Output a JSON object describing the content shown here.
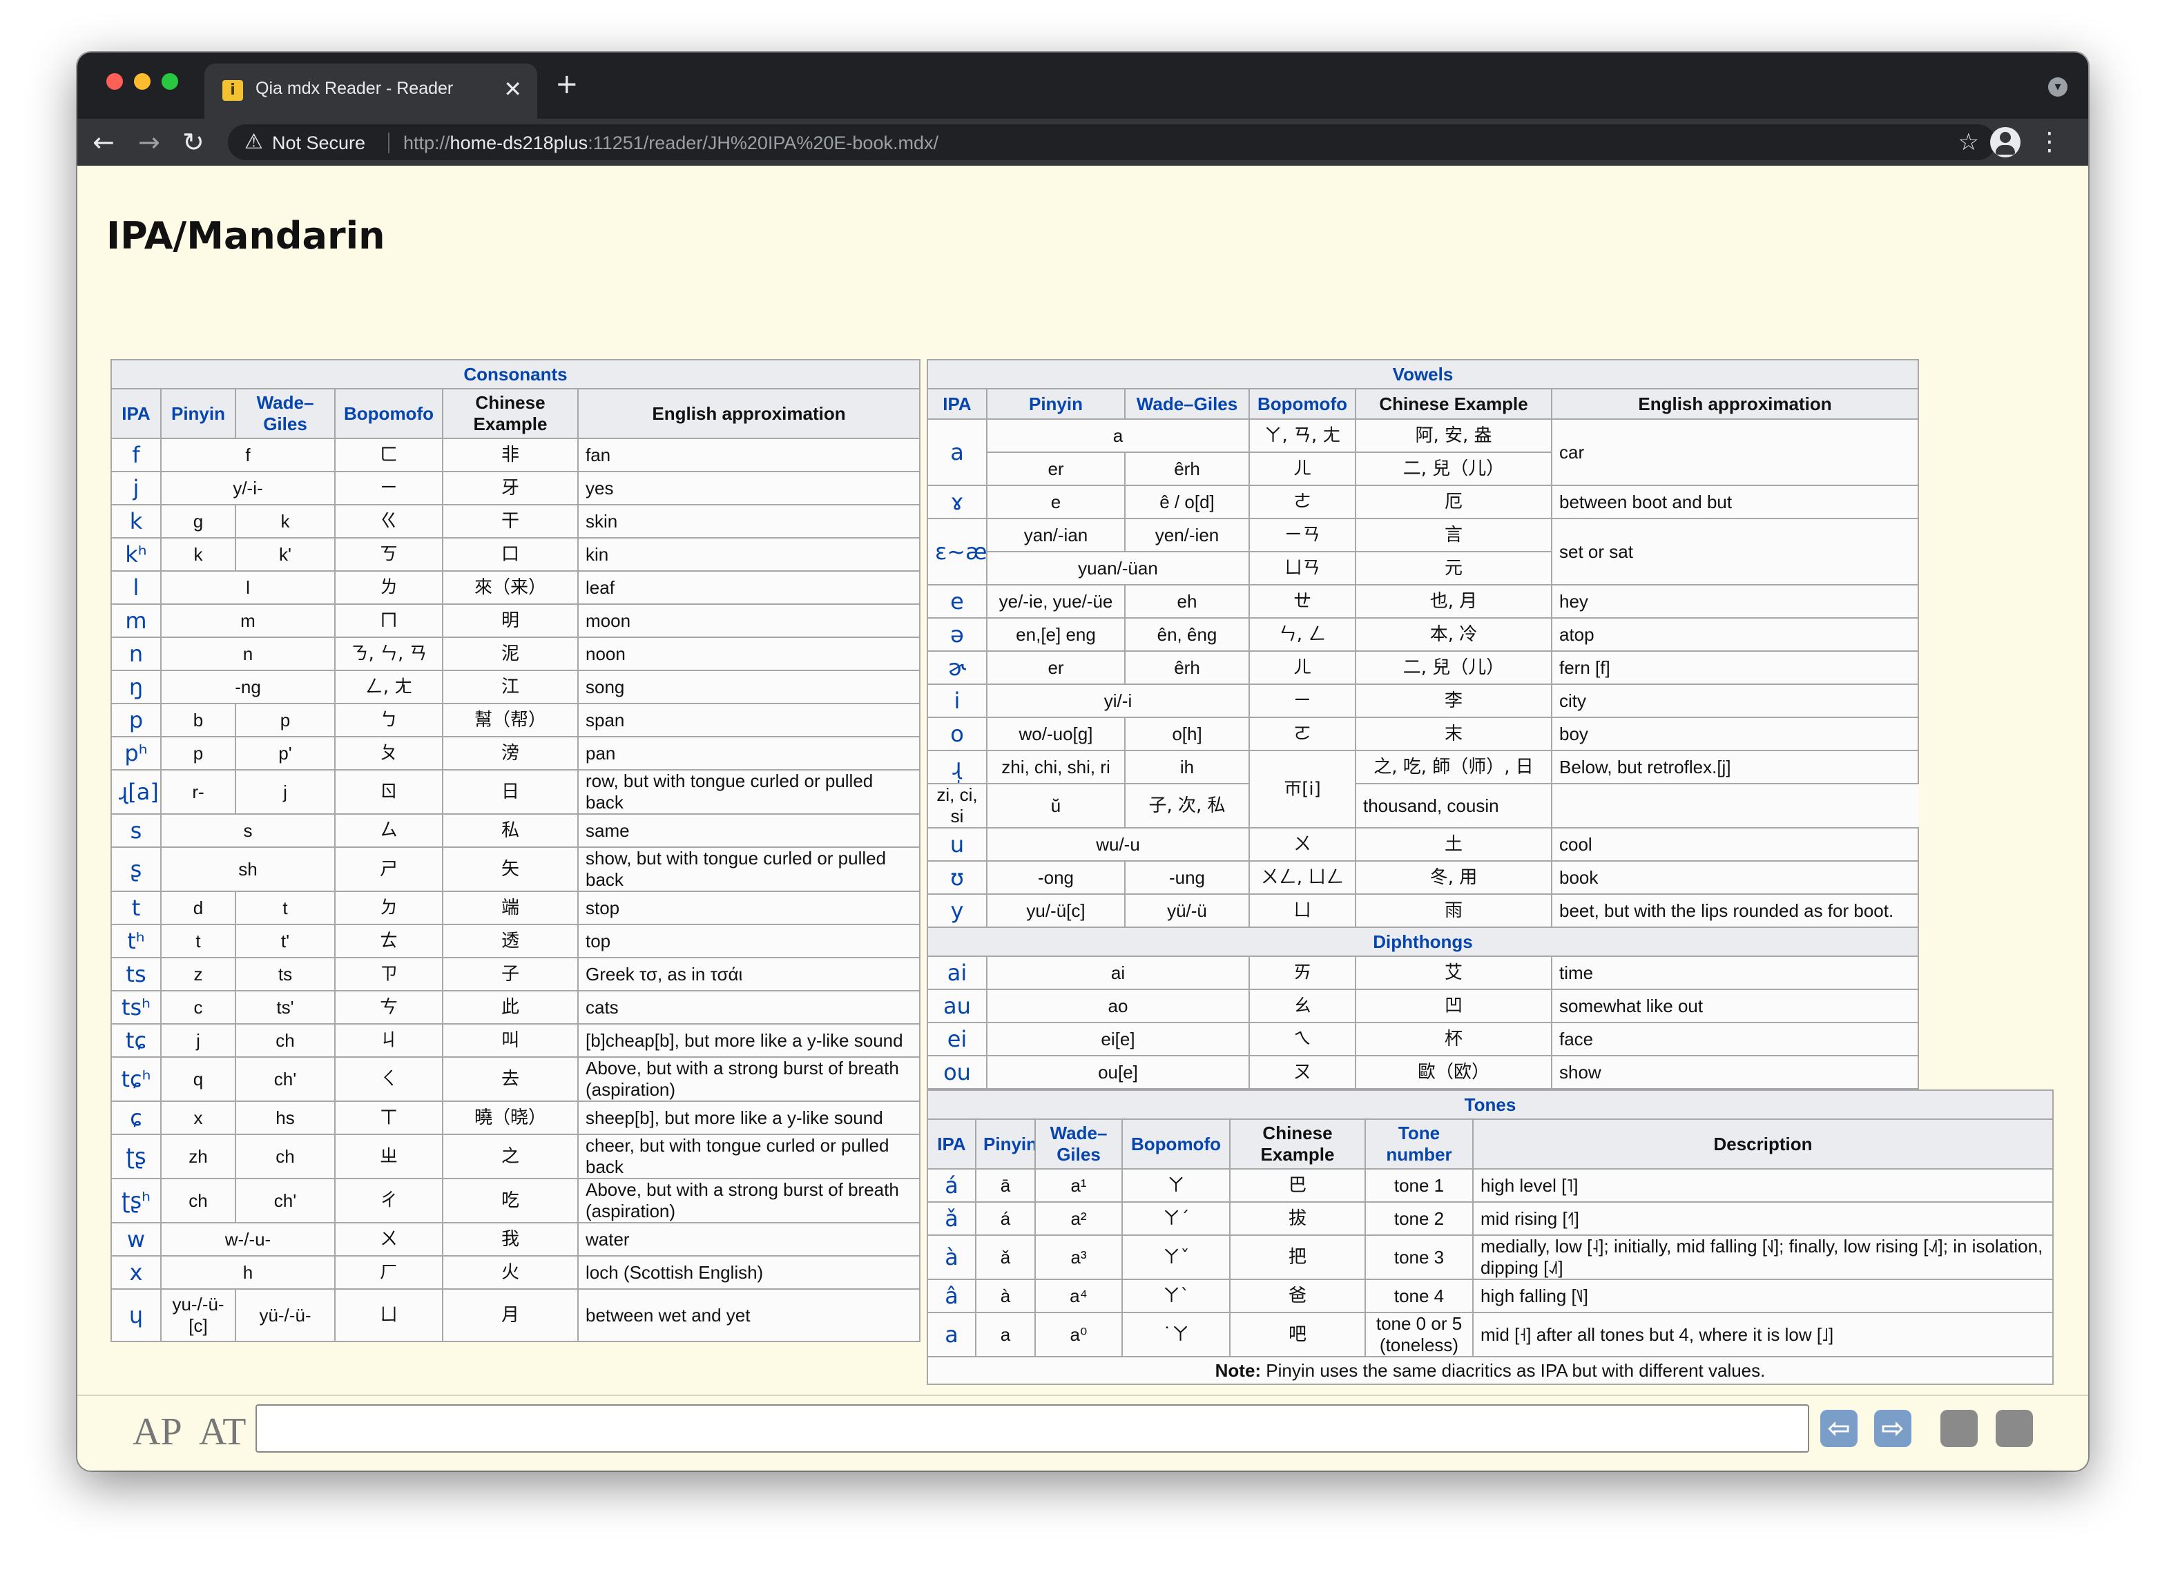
{
  "browser": {
    "tab_title": "Qia mdx Reader - Reader",
    "tab_close": "✕",
    "new_tab": "+",
    "favicon": "i",
    "not_secure": "Not Secure",
    "url_prefix": "http://",
    "url_host": "home-ds218plus",
    "url_rest": ":11251/reader/JH%20IPA%20E-book.mdx/",
    "back": "←",
    "forward": "→",
    "reload": "↻",
    "warn": "⚠",
    "star": "☆",
    "menu": "⋮",
    "profile_menu": "▾"
  },
  "page": {
    "title": "IPA/Mandarin"
  },
  "consonants": {
    "caption": "Consonants",
    "headers": [
      "IPA",
      "Pinyin",
      "Wade–Giles",
      "Bopomofo",
      "Chinese Example",
      "English approximation"
    ],
    "rows": [
      [
        "f",
        "f",
        "",
        "ㄈ",
        "非",
        "fan"
      ],
      [
        "j",
        "y/-i-",
        "",
        "ㄧ",
        "牙",
        "yes"
      ],
      [
        "k",
        "g",
        "k",
        "ㄍ",
        "干",
        "skin"
      ],
      [
        "kʰ",
        "k",
        "k'",
        "ㄎ",
        "口",
        "kin"
      ],
      [
        "l",
        "l",
        "",
        "ㄌ",
        "來（来）",
        "leaf"
      ],
      [
        "m",
        "m",
        "",
        "ㄇ",
        "明",
        "moon"
      ],
      [
        "n",
        "n",
        "",
        "ㄋ, ㄣ, ㄢ",
        "泥",
        "noon"
      ],
      [
        "ŋ",
        "-ng",
        "",
        "ㄥ, ㄤ",
        "江",
        "song"
      ],
      [
        "p",
        "b",
        "p",
        "ㄅ",
        "幫（帮）",
        "span"
      ],
      [
        "pʰ",
        "p",
        "p'",
        "ㄆ",
        "滂",
        "pan"
      ],
      [
        "ɻ[a]",
        "r-",
        "j",
        "ㄖ",
        "日",
        "row, but with tongue curled or pulled back"
      ],
      [
        "s",
        "s",
        "",
        "ㄙ",
        "私",
        "same"
      ],
      [
        "ʂ",
        "sh",
        "",
        "ㄕ",
        "矢",
        "show, but with tongue curled or pulled back"
      ],
      [
        "t",
        "d",
        "t",
        "ㄉ",
        "端",
        "stop"
      ],
      [
        "tʰ",
        "t",
        "t'",
        "ㄊ",
        "透",
        "top"
      ],
      [
        "ts",
        "z",
        "ts",
        "ㄗ",
        "子",
        "Greek τσ, as in τσάι"
      ],
      [
        "tsʰ",
        "c",
        "ts'",
        "ㄘ",
        "此",
        "cats"
      ],
      [
        "tɕ",
        "j",
        "ch",
        "ㄐ",
        "叫",
        "[b]cheap[b], but more like a y-like sound"
      ],
      [
        "tɕʰ",
        "q",
        "ch'",
        "ㄑ",
        "去",
        "Above, but with a strong burst of breath (aspiration)"
      ],
      [
        "ɕ",
        "x",
        "hs",
        "ㄒ",
        "曉（晓）",
        "sheep[b], but more like a y-like sound"
      ],
      [
        "ʈʂ",
        "zh",
        "ch",
        "ㄓ",
        "之",
        "cheer, but with tongue curled or pulled back"
      ],
      [
        "ʈʂʰ",
        "ch",
        "ch'",
        "ㄔ",
        "吃",
        "Above, but with a strong burst of breath (aspiration)"
      ],
      [
        "w",
        "w-/-u-",
        "",
        "ㄨ",
        "我",
        "water"
      ],
      [
        "x",
        "h",
        "",
        "ㄏ",
        "火",
        "loch (Scottish English)"
      ],
      [
        "ɥ",
        "yu-/-ü- [c]",
        "yü-/-ü-",
        "ㄩ",
        "月",
        "between wet and yet"
      ]
    ]
  },
  "vowels": {
    "caption": "Vowels",
    "headers": [
      "IPA",
      "Pinyin",
      "Wade–Giles",
      "Bopomofo",
      "Chinese Example",
      "English approximation"
    ],
    "rows": [
      [
        "a",
        "a",
        "",
        "ㄚ, ㄢ, ㄤ",
        "阿, 安, 盎",
        "car"
      ],
      [
        "",
        "er",
        "êrh",
        "ㄦ",
        "二, 兒（儿）",
        ""
      ],
      [
        "ɤ",
        "e",
        "ê / o[d]",
        "ㄜ",
        "厄",
        "between boot and but"
      ],
      [
        "ɛ~æ",
        "yan/-ian",
        "yen/-ien",
        "ㄧㄢ",
        "言",
        "set or sat"
      ],
      [
        "",
        "yuan/-üan",
        "",
        "ㄩㄢ",
        "元",
        ""
      ],
      [
        "e",
        "ye/-ie, yue/-üe",
        "eh",
        "ㄝ",
        "也, 月",
        "hey"
      ],
      [
        "ə",
        "en,[e] eng",
        "ên, êng",
        "ㄣ, ㄥ",
        "本, 冷",
        "atop"
      ],
      [
        "ɚ",
        "er",
        "êrh",
        "ㄦ",
        "二, 兒（儿）",
        "fern [f]"
      ],
      [
        "i",
        "yi/-i",
        "",
        "ㄧ",
        "李",
        "city"
      ],
      [
        "o",
        "wo/-uo[g]",
        "o[h]",
        "ㄛ",
        "末",
        "boy"
      ],
      [
        "ɻ̩",
        "zhi, chi, shi, ri",
        "ih",
        "ㄭ[i]",
        "之, 吃, 師（师）, 日",
        "Below, but retroflex.[j]"
      ],
      [
        "ɹ̩",
        "zi, ci, si",
        "ŭ",
        "",
        "子, 次, 私",
        "thousand, cousin"
      ],
      [
        "u",
        "wu/-u",
        "",
        "ㄨ",
        "土",
        "cool"
      ],
      [
        "ʊ",
        "-ong",
        "-ung",
        "ㄨㄥ, ㄩㄥ",
        "冬, 用",
        "book"
      ],
      [
        "y",
        "yu/-ü[c]",
        "yü/-ü",
        "ㄩ",
        "雨",
        "beet, but with the lips rounded as for boot."
      ]
    ],
    "diphthongs_caption": "Diphthongs",
    "diphthongs": [
      [
        "ai",
        "ai",
        "ㄞ",
        "艾",
        "time"
      ],
      [
        "au",
        "ao",
        "ㄠ",
        "凹",
        "somewhat like out"
      ],
      [
        "ei",
        "ei[e]",
        "ㄟ",
        "杯",
        "face"
      ],
      [
        "ou",
        "ou[e]",
        "ㄡ",
        "歐（欧）",
        "show"
      ]
    ]
  },
  "tones": {
    "caption": "Tones",
    "headers": [
      "IPA",
      "Pinyin",
      "Wade–Giles",
      "Bopomofo",
      "Chinese Example",
      "Tone number",
      "Description"
    ],
    "rows": [
      [
        "á",
        "ā",
        "a¹",
        "ㄚ",
        "巴",
        "tone 1",
        "high level [˥]"
      ],
      [
        "ǎ",
        "á",
        "a²",
        "ㄚˊ",
        "拔",
        "tone 2",
        "mid rising [˧˥]"
      ],
      [
        "à",
        "ǎ",
        "a³",
        "ㄚˇ",
        "把",
        "tone 3",
        "medially, low [˨]; initially, mid falling [˧˩]; finally, low rising [˨˩˦]; in isolation, dipping [˨˩˦]"
      ],
      [
        "â",
        "à",
        "a⁴",
        "ㄚˋ",
        "爸",
        "tone 4",
        "high falling [˥˩]"
      ],
      [
        "a",
        "a",
        "a⁰",
        "˙ㄚ",
        "吧",
        "tone 0 or 5 (toneless)",
        "mid [˧] after all tones but 4, where it is low [˩]"
      ]
    ],
    "note_label": "Note:",
    "note_text": "Pinyin uses the same diacritics as IPA but with different values."
  },
  "bottombar": {
    "ap": "AP",
    "at": "AT",
    "prev": "⇦",
    "next": "⇨"
  }
}
